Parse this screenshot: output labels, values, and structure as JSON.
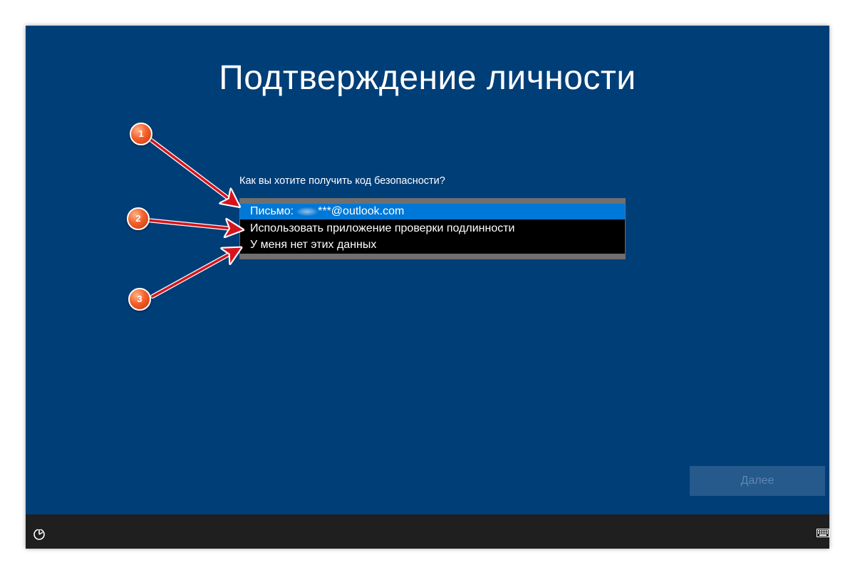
{
  "screen": {
    "title": "Подтверждение личности",
    "question": "Как вы хотите получить код безопасности?",
    "options": [
      {
        "label_prefix": "Письмо:",
        "label_suffix": "***@outlook.com",
        "selected": true
      },
      {
        "label": "Использовать приложение проверки подлинности",
        "selected": false
      },
      {
        "label": "У меня нет этих данных",
        "selected": false
      }
    ],
    "next_button": "Далее"
  },
  "taskbar": {
    "left_icon": "ease-of-access-icon",
    "right_icon": "keyboard-icon"
  },
  "annotations": [
    {
      "number": "1"
    },
    {
      "number": "2"
    },
    {
      "number": "3"
    }
  ],
  "colors": {
    "background": "#003e78",
    "selected": "#0078d7",
    "listbox": "#000000",
    "taskbar": "#1f1f1f",
    "button": "#26598c",
    "badge": "#f3602a",
    "arrow": "#d7141c"
  }
}
